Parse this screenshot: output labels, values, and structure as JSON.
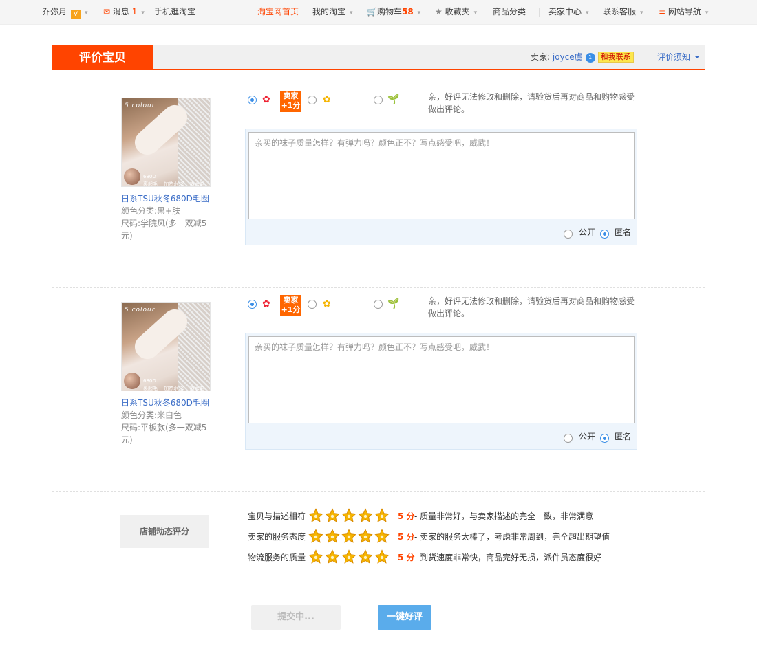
{
  "topbar": {
    "user": "乔弥月",
    "messages_label": "消息",
    "messages_count": "1",
    "mobile": "手机逛淘宝",
    "home": "淘宝网首页",
    "my_taobao": "我的淘宝",
    "cart_label": "购物车",
    "cart_count": "58",
    "favorites": "收藏夹",
    "categories": "商品分类",
    "seller_center": "卖家中心",
    "customer_service": "联系客服",
    "site_nav": "网站导航",
    "vip_badge": "V"
  },
  "panel": {
    "tab_title": "评价宝贝",
    "seller_label": "卖家:",
    "seller_name": "joyce虞",
    "contact_badge": "1",
    "contact_label": "和我联系",
    "notice": "评价须知"
  },
  "items": [
    {
      "name": "日系TSU秋冬680D毛圈",
      "color": "颜色分类:黑+肤",
      "size": "尺码:学院风(多一双减5元)",
      "image_text": {
        "brand": "5 colour",
        "denier": "680D",
        "caption": "裏起毛 一加热水,多一热水能"
      },
      "rating": "good",
      "bonus": "卖家\n+1分",
      "tip": "亲，好评无法修改和删除，请验货后再对商品和购物感受做出评论。",
      "placeholder": "亲买的袜子质量怎样？有弹力吗？颜色正不？写点感受吧，威武！",
      "public_label": "公开",
      "anonymous_label": "匿名",
      "visibility": "anonymous"
    },
    {
      "name": "日系TSU秋冬680D毛圈",
      "color": "颜色分类:米白色",
      "size": "尺码:平板款(多一双减5元)",
      "image_text": {
        "brand": "5 colour",
        "denier": "680D",
        "caption": "裏起毛 一加热水,多一热水能"
      },
      "rating": "good",
      "bonus": "卖家\n+1分",
      "tip": "亲，好评无法修改和删除，请验货后再对商品和购物感受做出评论。",
      "placeholder": "亲买的袜子质量怎样？有弹力吗？颜色正不？写点感受吧，威武！",
      "public_label": "公开",
      "anonymous_label": "匿名",
      "visibility": "anonymous"
    }
  ],
  "dsr": {
    "label": "店铺动态评分",
    "rows": [
      {
        "label": "宝贝与描述相符",
        "score": "5 分",
        "stars": 5,
        "desc": "- 质量非常好，与卖家描述的完全一致，非常满意"
      },
      {
        "label": "卖家的服务态度",
        "score": "5 分",
        "stars": 5,
        "desc": "- 卖家的服务太棒了，考虑非常周到，完全超出期望值"
      },
      {
        "label": "物流服务的质量",
        "score": "5 分",
        "stars": 5,
        "desc": "- 到货速度非常快，商品完好无损，派件员态度很好"
      }
    ]
  },
  "actions": {
    "submit": "提交中...",
    "one_click": "一键好评"
  },
  "colors": {
    "accent": "#ff4400",
    "link": "#3c6ec7",
    "radio": "#3a8ee6",
    "star": "#f5b400"
  }
}
